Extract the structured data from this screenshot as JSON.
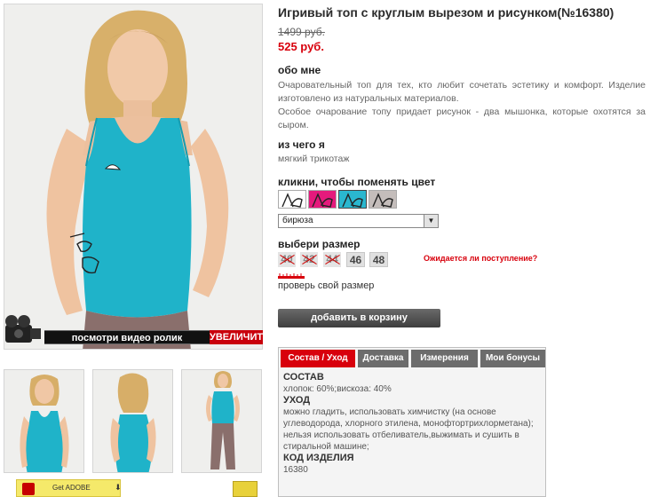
{
  "product": {
    "title": "Игривый топ с круглым вырезом и рисунком(№16380)",
    "old_price": "1499 руб.",
    "new_price": "525 руб."
  },
  "about": {
    "heading": "обо мне",
    "lines": [
      "Очаровательный топ для тех, кто любит сочетать эстетику и комфорт. Изделие изготовлено из натуральных материалов.",
      "Особое очарование топу придает рисунок - два мышонка, которые охотятся за сыром."
    ]
  },
  "material": {
    "heading": "из чего я",
    "text": "мягкий трикотаж"
  },
  "color": {
    "heading": "кликни, чтобы поменять цвет",
    "selected": "бирюза",
    "swatches": [
      "white",
      "pink",
      "turquoise",
      "grey"
    ],
    "swatch_colors": [
      "#ffffff",
      "#e51a7c",
      "#2ab7cf",
      "#c4bdbb"
    ]
  },
  "size": {
    "heading": "выбери размер",
    "options": [
      {
        "label": "40",
        "available": false
      },
      {
        "label": "42",
        "available": false
      },
      {
        "label": "44",
        "available": false
      },
      {
        "label": "46",
        "available": true
      },
      {
        "label": "48",
        "available": true
      }
    ],
    "notify_link": "Ожидается ли поступление?",
    "check_link": "проверь свой размер"
  },
  "cart_button": "добавить в корзину",
  "media": {
    "video_label": "посмотри видео ролик",
    "zoom_label": "УВЕЛИЧИТЬ",
    "adobe_label": "Get ADOBE"
  },
  "tabs": {
    "items": [
      "Состав / Уход",
      "Доставка",
      "Измерения",
      "Мои бонусы"
    ],
    "active_index": 0,
    "content": {
      "composition_head": "СОСТАВ",
      "composition": "хлопок: 60%;вискоза: 40%",
      "care_head": "УХОД",
      "care": "можно гладить, использовать химчистку (на основе углеводорода, хлорного этилена, монофтортрихлорметана); нельзя использовать отбеливатель,выжимать и сушить в стиральной машине;",
      "code_head": "КОД ИЗДЕЛИЯ",
      "code": "16380"
    }
  },
  "colors": {
    "accent": "#d8000c",
    "shirt": "#1fb3c9",
    "tab_inactive": "#6c6c6c"
  }
}
